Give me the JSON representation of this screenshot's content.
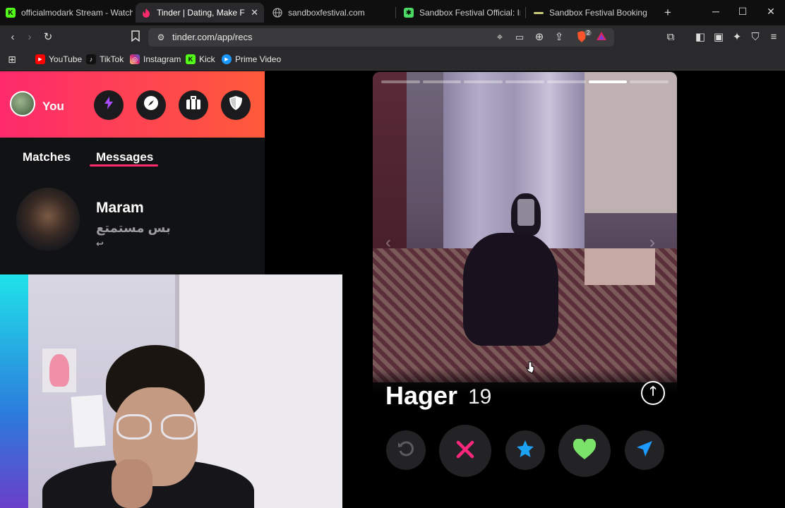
{
  "browser": {
    "tabs": [
      {
        "title": "officialmodark Stream - Watch",
        "icon": "kick-icon",
        "color": "#53fc18"
      },
      {
        "title": "Tinder | Dating, Make Frien",
        "icon": "tinder-flame-icon",
        "color": "#fd2a6c"
      },
      {
        "title": "sandboxfestival.com",
        "icon": "globe-icon",
        "color": "#aaaaaa"
      },
      {
        "title": "Sandbox Festival Official: Instag",
        "icon": "sandbox-icon",
        "color": "#4cd964"
      },
      {
        "title": "Sandbox Festival Booking",
        "icon": "sandbox-booking-icon",
        "color": "#c9c97a"
      }
    ],
    "new_tab_symbol": "+",
    "url": "tinder.com/app/recs",
    "bookmarks": [
      {
        "label": "YouTube",
        "icon": "youtube-icon",
        "color": "#ff0000"
      },
      {
        "label": "TikTok",
        "icon": "tiktok-icon",
        "color": "#111111"
      },
      {
        "label": "Instagram",
        "icon": "instagram-icon",
        "color": "#e1306c"
      },
      {
        "label": "Kick",
        "icon": "kick-icon",
        "color": "#53fc18"
      },
      {
        "label": "Prime Video",
        "icon": "prime-video-icon",
        "color": "#1a98ff"
      }
    ],
    "brave_badge": "2"
  },
  "tinder": {
    "you_label": "You",
    "header_buttons": [
      "boost-icon",
      "explore-icon",
      "passport-icon",
      "safety-shield-icon"
    ],
    "tabs": {
      "matches": "Matches",
      "messages": "Messages",
      "active": "Messages"
    },
    "conversations": [
      {
        "name": "Maram",
        "last_message": "بس مستمتع"
      }
    ],
    "profile": {
      "name": "Hager",
      "age": "19",
      "photo_count": 7,
      "active_photo": 6
    },
    "actions": [
      {
        "name": "rewind",
        "icon": "rewind-icon",
        "color": "#5b5b60"
      },
      {
        "name": "nope",
        "icon": "nope-x-icon",
        "color": "#fd267a"
      },
      {
        "name": "super-like",
        "icon": "star-icon",
        "color": "#1da1f2"
      },
      {
        "name": "like",
        "icon": "heart-icon",
        "color": "#7be36a"
      },
      {
        "name": "boost",
        "icon": "send-icon",
        "color": "#1e9bff"
      }
    ],
    "accent": "#fd2a6c"
  }
}
